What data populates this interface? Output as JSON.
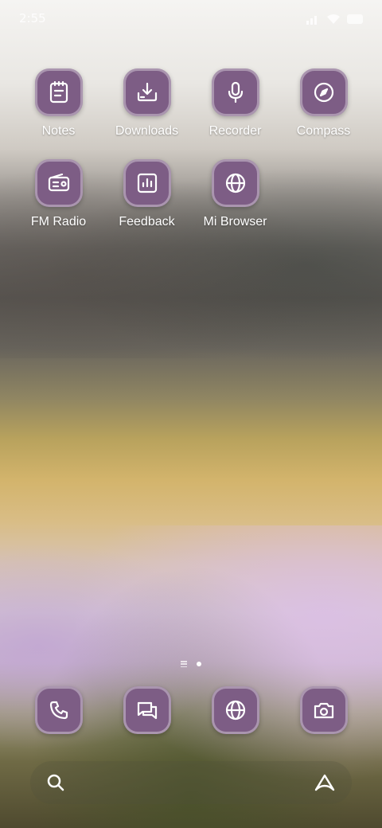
{
  "status_bar": {
    "time": "2:55"
  },
  "apps": [
    {
      "label": "Notes",
      "icon": "notes-icon"
    },
    {
      "label": "Downloads",
      "icon": "download-icon"
    },
    {
      "label": "Recorder",
      "icon": "microphone-icon"
    },
    {
      "label": "Compass",
      "icon": "compass-icon"
    },
    {
      "label": "FM Radio",
      "icon": "radio-icon"
    },
    {
      "label": "Feedback",
      "icon": "bar-chart-icon"
    },
    {
      "label": "Mi Browser",
      "icon": "globe-icon"
    }
  ],
  "dock": [
    {
      "icon": "phone-icon"
    },
    {
      "icon": "messages-icon"
    },
    {
      "icon": "globe-icon"
    },
    {
      "icon": "camera-icon"
    }
  ],
  "search_bar": {
    "left_icon": "search-icon",
    "right_icon": "assistant-icon"
  },
  "page_indicator": {
    "pages": 1,
    "current": 1
  },
  "colors": {
    "icon_background": "#7d5d85",
    "icon_glyph": "#ffffff",
    "label": "#ffffff"
  }
}
